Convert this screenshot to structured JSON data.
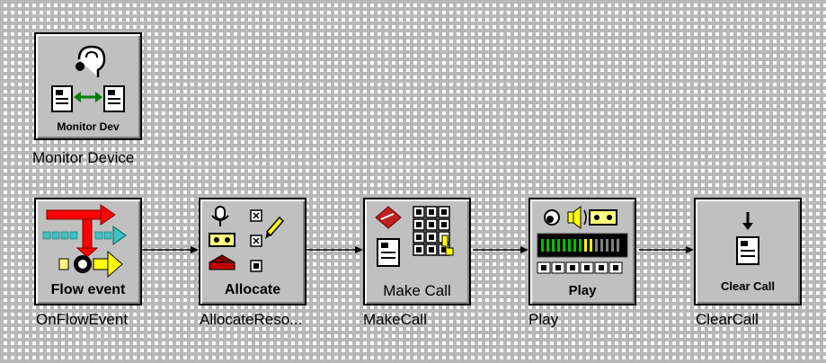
{
  "nodes": [
    {
      "caption": "Monitor Dev",
      "label": "Monitor Device"
    },
    {
      "caption": "Flow event",
      "label": "OnFlowEvent"
    },
    {
      "caption": "Allocate",
      "label": "AllocateReso..."
    },
    {
      "caption": "Make Call",
      "label": "MakeCall"
    },
    {
      "caption": "Play",
      "label": "Play"
    },
    {
      "caption": "Clear Call",
      "label": "ClearCall"
    }
  ],
  "colors": {
    "node_bg": "#c0c0c0",
    "grid": "#b8b8b8",
    "connector": "#000000"
  }
}
